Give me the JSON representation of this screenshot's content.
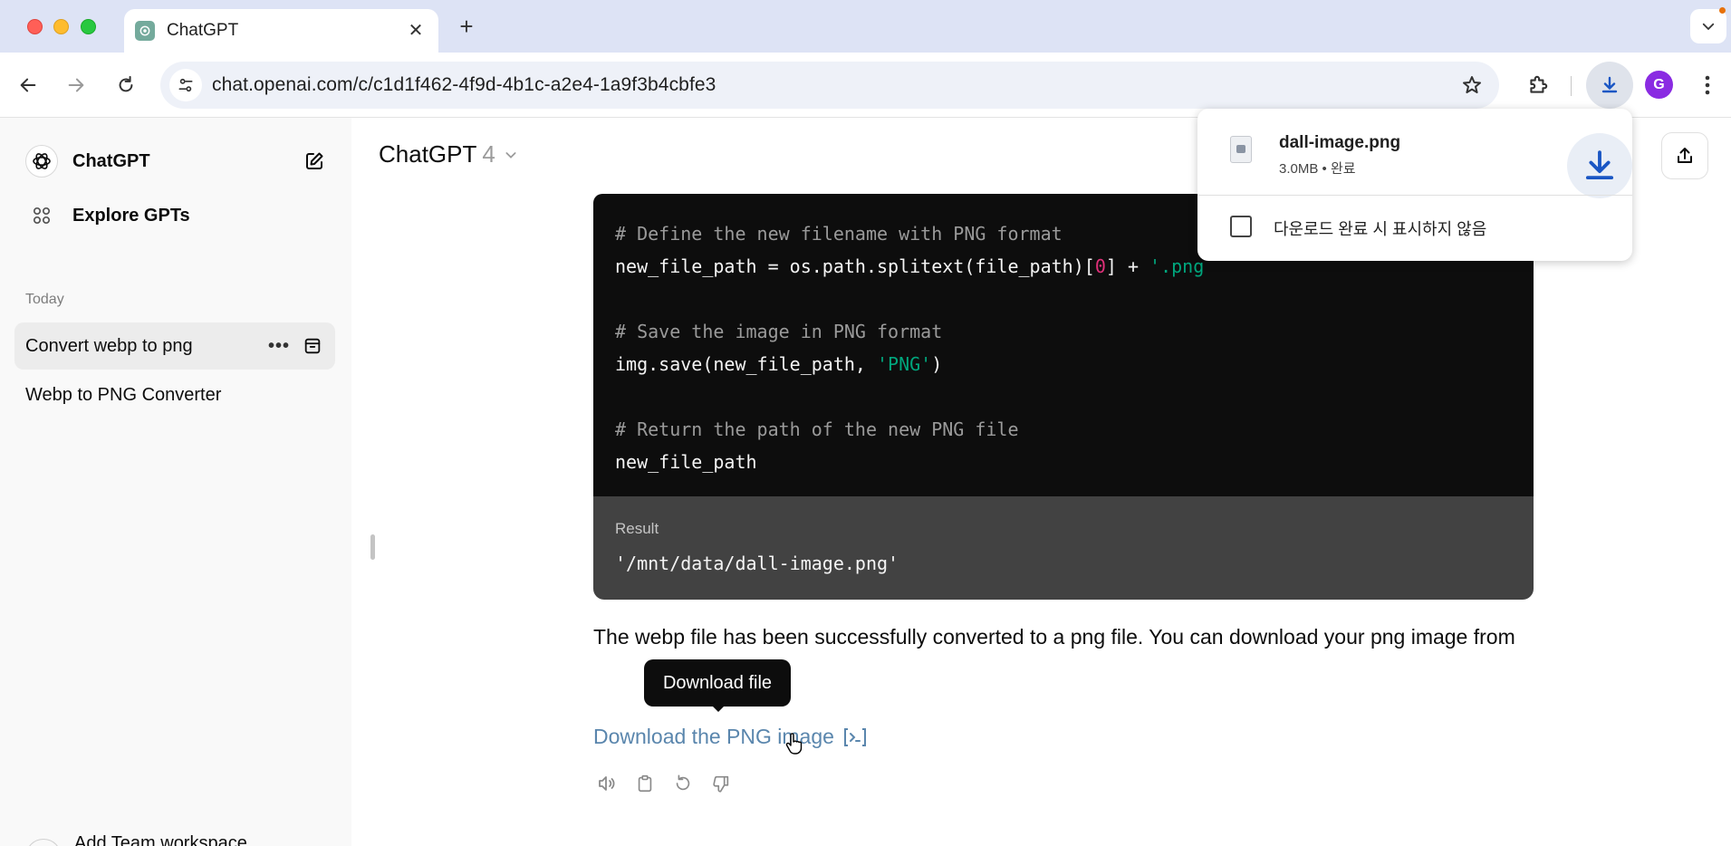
{
  "browser": {
    "tab_title": "ChatGPT",
    "url": "chat.openai.com/c/c1d1f462-4f9d-4b1c-a2e4-1a9f3b4cbfe3",
    "profile_initial": "G"
  },
  "sidebar": {
    "app_name": "ChatGPT",
    "explore_label": "Explore GPTs",
    "section_today": "Today",
    "chats": [
      {
        "label": "Convert webp to png",
        "active": true
      },
      {
        "label": "Webp to PNG Converter",
        "active": false
      }
    ],
    "team_label": "Add Team workspace"
  },
  "main": {
    "model_name": "ChatGPT",
    "model_version": "4",
    "code_lines": [
      "# Define the new filename with PNG format",
      "new_file_path = os.path.splitext(file_path)[0] + '.png",
      "",
      "# Save the image in PNG format",
      "img.save(new_file_path, 'PNG')",
      "",
      "# Return the path of the new PNG file",
      "new_file_path"
    ],
    "result_label": "Result",
    "result_value": "'/mnt/data/dall-image.png'",
    "message": "The webp file has been successfully converted to a png file. You can download your png image from",
    "tooltip": "Download file",
    "download_link": "Download the PNG image"
  },
  "download_popup": {
    "filename": "dall-image.png",
    "meta": "3.0MB • 완료",
    "checkbox_label": "다운로드 완료 시 표시하지 않음",
    "checkbox_checked": false
  },
  "colors": {
    "accent_link": "#5a86ad",
    "profile": "#8a2be2",
    "code_bg": "#0d0d0d",
    "result_bg": "#424242"
  }
}
